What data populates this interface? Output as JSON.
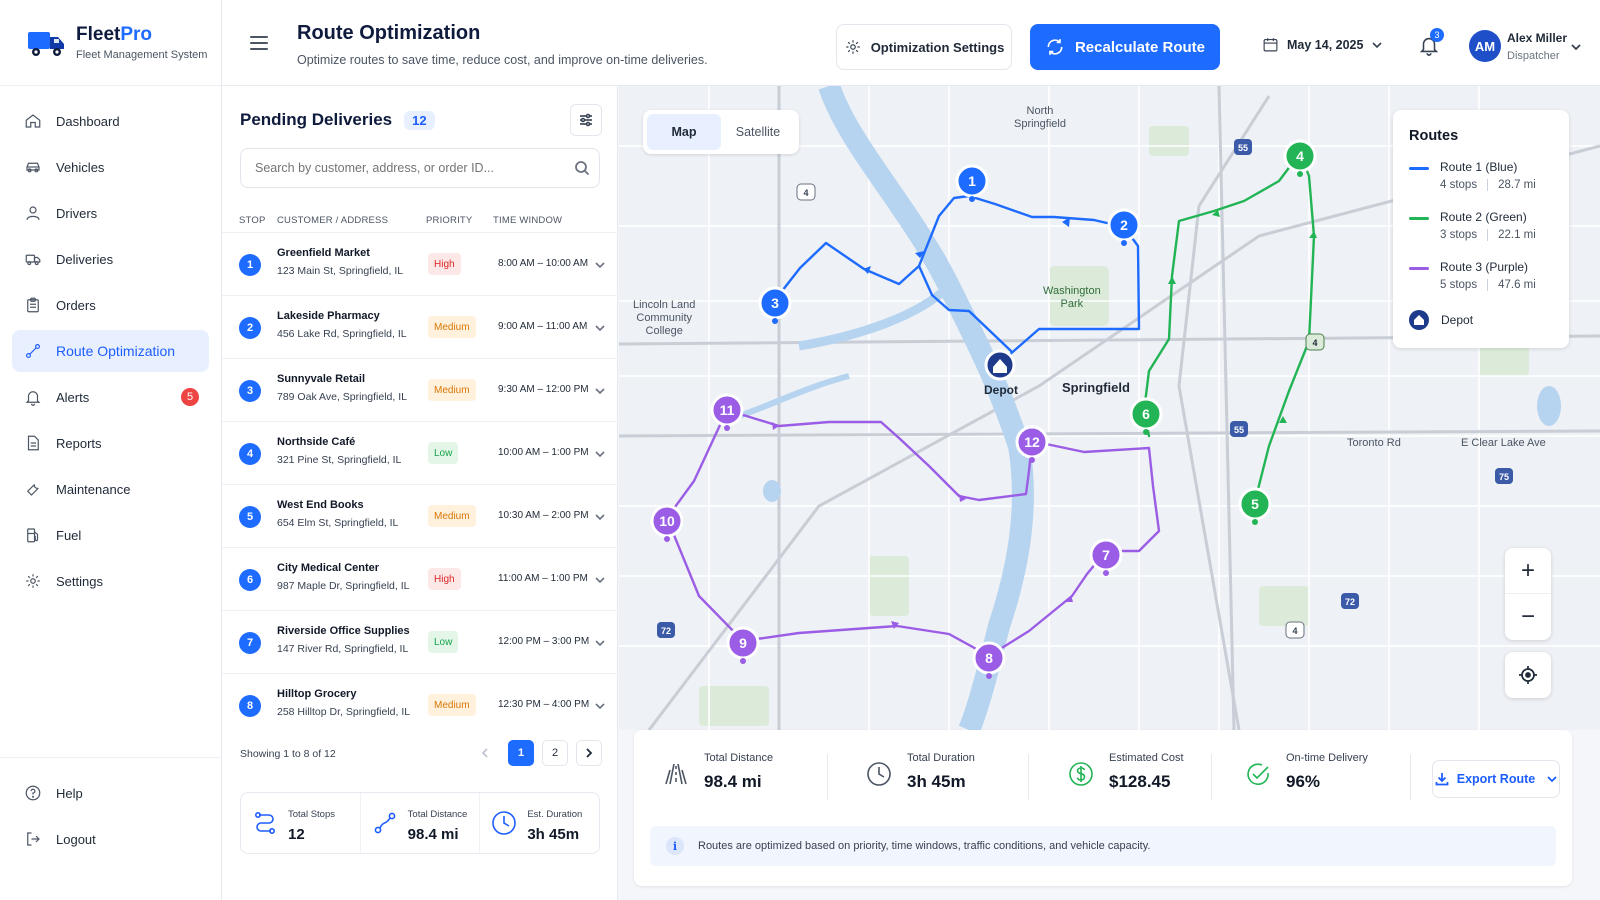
{
  "brand": {
    "name_main": "Fleet",
    "name_accent": "Pro",
    "subtitle": "Fleet Management System"
  },
  "header": {
    "title": "Route Optimization",
    "subtitle": "Optimize routes to save time, reduce cost, and improve on-time deliveries.",
    "settings_label": "Optimization Settings",
    "recalc_label": "Recalculate Route",
    "date": "May 14, 2025",
    "notification_count": "3",
    "user": {
      "initials": "AM",
      "name": "Alex Miller",
      "role": "Dispatcher"
    }
  },
  "nav": {
    "items": [
      {
        "label": "Dashboard",
        "icon": "home-icon"
      },
      {
        "label": "Vehicles",
        "icon": "car-icon"
      },
      {
        "label": "Drivers",
        "icon": "user-icon"
      },
      {
        "label": "Deliveries",
        "icon": "truck-icon"
      },
      {
        "label": "Orders",
        "icon": "clipboard-icon"
      },
      {
        "label": "Route Optimization",
        "icon": "route-icon",
        "active": true
      },
      {
        "label": "Alerts",
        "icon": "bell-icon",
        "badge": "5"
      },
      {
        "label": "Reports",
        "icon": "document-icon"
      },
      {
        "label": "Maintenance",
        "icon": "wrench-icon"
      },
      {
        "label": "Fuel",
        "icon": "fuel-icon"
      },
      {
        "label": "Settings",
        "icon": "gear-icon"
      }
    ],
    "bottom": [
      {
        "label": "Help",
        "icon": "help-icon"
      },
      {
        "label": "Logout",
        "icon": "logout-icon"
      }
    ]
  },
  "deliveries": {
    "title": "Pending Deliveries",
    "count": "12",
    "search_placeholder": "Search by customer, address, or order ID...",
    "columns": {
      "stop": "STOP",
      "customer": "CUSTOMER / ADDRESS",
      "priority": "PRIORITY",
      "time": "TIME WINDOW"
    },
    "rows": [
      {
        "stop": "1",
        "customer": "Greenfield Market",
        "address": "123 Main St, Springfield, IL",
        "priority": "High",
        "window": "8:00 AM – 10:00 AM"
      },
      {
        "stop": "2",
        "customer": "Lakeside Pharmacy",
        "address": "456 Lake Rd, Springfield, IL",
        "priority": "Medium",
        "window": "9:00 AM – 11:00 AM"
      },
      {
        "stop": "3",
        "customer": "Sunnyvale Retail",
        "address": "789 Oak Ave, Springfield, IL",
        "priority": "Medium",
        "window": "9:30 AM – 12:00 PM"
      },
      {
        "stop": "4",
        "customer": "Northside Café",
        "address": "321 Pine St, Springfield, IL",
        "priority": "Low",
        "window": "10:00 AM – 1:00 PM"
      },
      {
        "stop": "5",
        "customer": "West End Books",
        "address": "654 Elm St, Springfield, IL",
        "priority": "Medium",
        "window": "10:30 AM – 2:00 PM"
      },
      {
        "stop": "6",
        "customer": "City Medical Center",
        "address": "987 Maple Dr, Springfield, IL",
        "priority": "High",
        "window": "11:00 AM – 1:00 PM"
      },
      {
        "stop": "7",
        "customer": "Riverside Office Supplies",
        "address": "147 River Rd, Springfield, IL",
        "priority": "Low",
        "window": "12:00 PM – 3:00 PM"
      },
      {
        "stop": "8",
        "customer": "Hilltop Grocery",
        "address": "258 Hilltop Dr, Springfield, IL",
        "priority": "Medium",
        "window": "12:30 PM – 4:00 PM"
      }
    ],
    "pager": {
      "showing": "Showing 1 to 8 of 12",
      "page1": "1",
      "page2": "2"
    },
    "summary": [
      {
        "label": "Total Stops",
        "value": "12"
      },
      {
        "label": "Total Distance",
        "value": "98.4 mi"
      },
      {
        "label": "Est. Duration",
        "value": "3h 45m"
      }
    ]
  },
  "map": {
    "view_map": "Map",
    "view_satellite": "Satellite",
    "labels": {
      "north_springfield": "North\nSpringfield",
      "lincoln": "Lincoln Land\nCommunity\nCollege",
      "washington": "Washington\nPark",
      "springfield": "Springfield",
      "toronto": "Toronto Rd",
      "clear_lake": "E Clear Lake Ave",
      "depot": "Depot"
    },
    "shields": {
      "s4a": "4",
      "s55a": "55",
      "s55b": "55",
      "s4b": "4",
      "s4c": "4",
      "s72a": "72",
      "s72b": "72",
      "s75": "75"
    },
    "legend": {
      "title": "Routes",
      "routes": [
        {
          "name": "Route 1 (Blue)",
          "stops": "4 stops",
          "distance": "28.7 mi",
          "color": "#1e6bff"
        },
        {
          "name": "Route 2 (Green)",
          "stops": "3 stops",
          "distance": "22.1 mi",
          "color": "#22b455"
        },
        {
          "name": "Route 3 (Purple)",
          "stops": "5 stops",
          "distance": "47.6 mi",
          "color": "#9b5de5"
        }
      ],
      "depot_label": "Depot"
    },
    "markers": [
      {
        "n": "1",
        "route": "blue"
      },
      {
        "n": "2",
        "route": "blue"
      },
      {
        "n": "3",
        "route": "blue"
      },
      {
        "n": "4",
        "route": "green"
      },
      {
        "n": "5",
        "route": "green"
      },
      {
        "n": "6",
        "route": "green"
      },
      {
        "n": "7",
        "route": "purple"
      },
      {
        "n": "8",
        "route": "purple"
      },
      {
        "n": "9",
        "route": "purple"
      },
      {
        "n": "10",
        "route": "purple"
      },
      {
        "n": "11",
        "route": "purple"
      },
      {
        "n": "12",
        "route": "purple"
      }
    ],
    "zoom_in": "+",
    "zoom_out": "−"
  },
  "stats": {
    "items": [
      {
        "label": "Total Distance",
        "value": "98.4 mi"
      },
      {
        "label": "Total Duration",
        "value": "3h 45m"
      },
      {
        "label": "Estimated Cost",
        "value": "$128.45"
      },
      {
        "label": "On-time Delivery",
        "value": "96%"
      }
    ],
    "export_label": "Export Route",
    "info": "Routes are optimized based on priority, time windows, traffic conditions, and vehicle capacity.",
    "info_icon": "i"
  },
  "colors": {
    "accent": "#1e6bff",
    "blue_route": "#1e6bff",
    "green_route": "#22b455",
    "purple_route": "#9b5de5",
    "depot": "#1e3a8a"
  }
}
